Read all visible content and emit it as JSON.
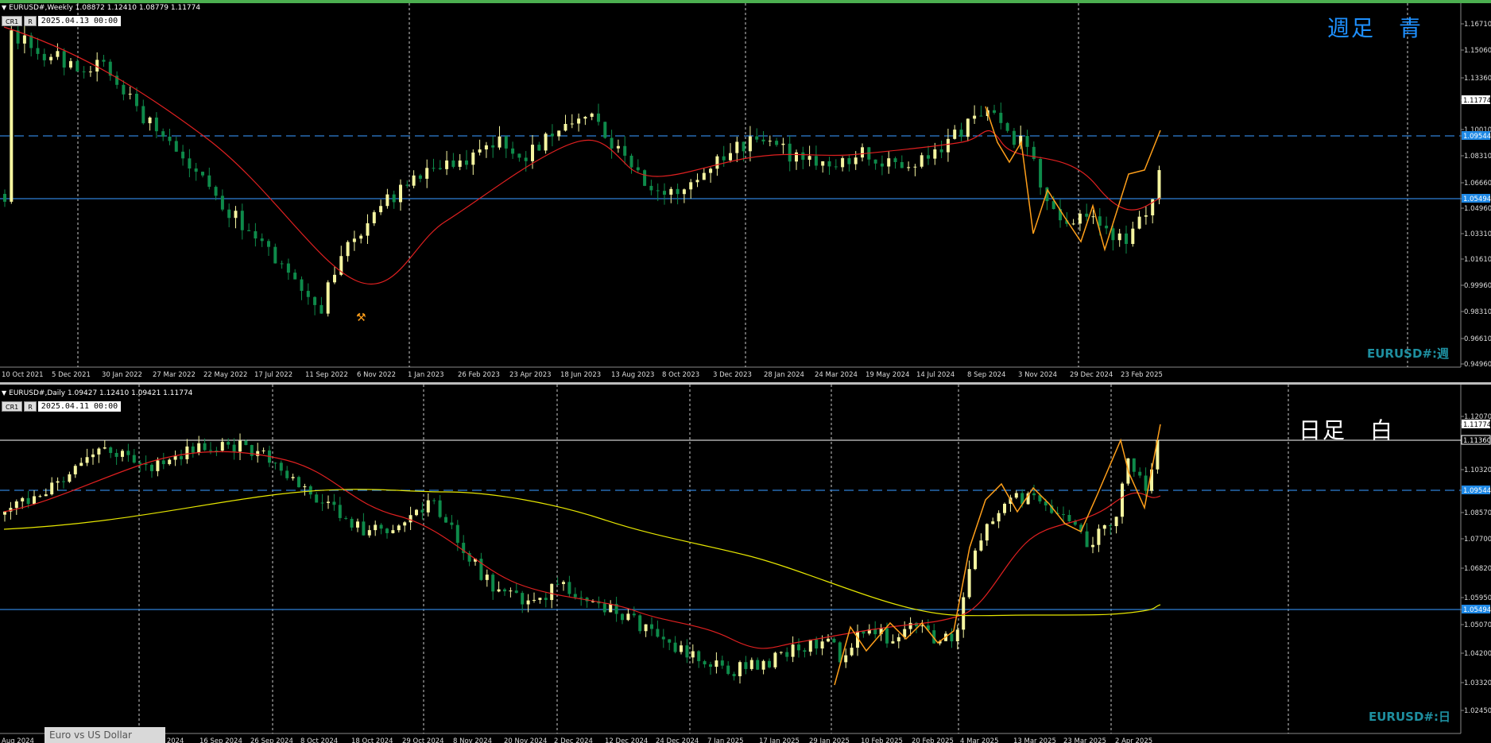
{
  "weekly": {
    "header": "EURUSD#,Weekly 1.08872 1.12410 1.08779 1.11774",
    "btn_cr": "CR1",
    "btn_r": "R",
    "date_box": "2025.04.13 00:00",
    "note": "週足　青",
    "symbol_label": "EURUSD#:週",
    "price_ticks": [
      "1.16710",
      "1.15060",
      "1.13360",
      "1.11774",
      "1.10010",
      "1.09544",
      "1.08310",
      "1.06660",
      "1.05494",
      "1.04960",
      "1.03310",
      "1.01610",
      "0.99960",
      "0.98310",
      "0.96610",
      "0.94960"
    ],
    "time_ticks": [
      "10 Oct 2021",
      "5 Dec 2021",
      "30 Jan 2022",
      "27 Mar 2022",
      "22 May 2022",
      "17 Jul 2022",
      "11 Sep 2022",
      "6 Nov 2022",
      "1 Jan 2023",
      "26 Feb 2023",
      "23 Apr 2023",
      "18 Jun 2023",
      "13 Aug 2023",
      "8 Oct 2023",
      "3 Dec 2023",
      "28 Jan 2024",
      "24 Mar 2024",
      "19 May 2024",
      "14 Jul 2024",
      "8 Sep 2024",
      "3 Nov 2024",
      "29 Dec 2024",
      "23 Feb 2025"
    ],
    "levels": {
      "dashed": "1.09544",
      "solid": "1.05494",
      "last": "1.11774"
    }
  },
  "daily": {
    "header": "EURUSD#,Daily 1.09427 1.12410 1.09421 1.11774",
    "btn_cr": "CR1",
    "btn_r": "R",
    "date_box": "2025.04.11 00:00",
    "note": "日足　白",
    "symbol_label": "EURUSD#:日",
    "price_ticks": [
      "1.12070",
      "1.11774",
      "1.11360",
      "1.10320",
      "1.09544",
      "1.08570",
      "1.07700",
      "1.06820",
      "1.05950",
      "1.05494",
      "1.05070",
      "1.04200",
      "1.03320",
      "1.02450"
    ],
    "time_ticks": [
      "Aug 2024",
      "2024",
      "4 Sep 2024",
      "16 Sep 2024",
      "26 Sep 2024",
      "8 Oct 2024",
      "18 Oct 2024",
      "29 Oct 2024",
      "8 Nov 2024",
      "20 Nov 2024",
      "2 Dec 2024",
      "12 Dec 2024",
      "24 Dec 2024",
      "7 Jan 2025",
      "17 Jan 2025",
      "29 Jan 2025",
      "10 Feb 2025",
      "20 Feb 2025",
      "4 Mar 2025",
      "13 Mar 2025",
      "23 Mar 2025",
      "2 Apr 2025"
    ],
    "levels": {
      "white": "1.11360",
      "dashed": "1.09544",
      "solid": "1.05494",
      "last": "1.11774"
    }
  },
  "status_tab": "Euro vs US Dollar",
  "colors": {
    "bull": "#f5f5a0",
    "bear": "#0e8a4a",
    "ma_red": "#e02020",
    "ma_yellow": "#e6e600",
    "zigzag": "#ff9f1a",
    "level_blue": "#2f7fd6",
    "symbol": "#1e8fa0",
    "note_blue": "#1e90ff"
  }
}
